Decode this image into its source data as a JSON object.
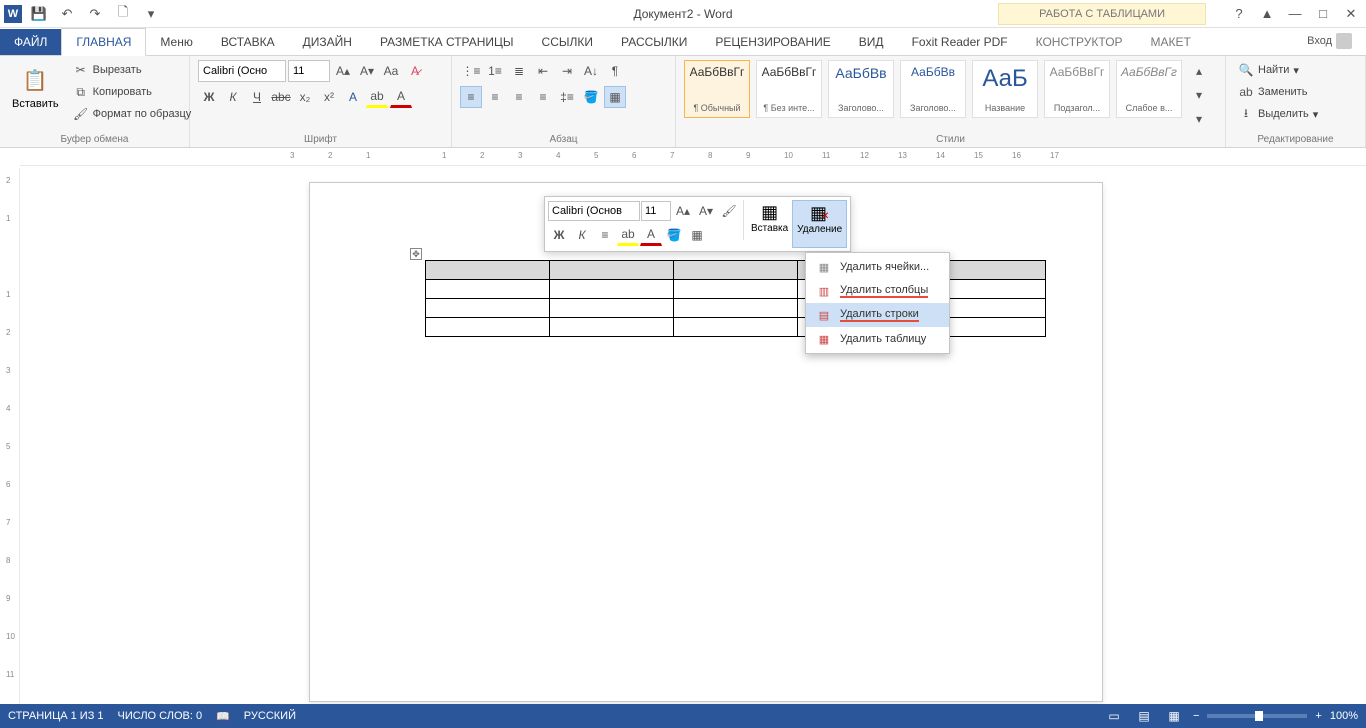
{
  "titlebar": {
    "doc_title": "Документ2 - Word",
    "table_tools": "РАБОТА С ТАБЛИЦАМИ"
  },
  "tabs": {
    "file": "ФАЙЛ",
    "home": "ГЛАВНАЯ",
    "menu": "Меню",
    "insert": "ВСТАВКА",
    "design": "ДИЗАЙН",
    "layout": "РАЗМЕТКА СТРАНИЦЫ",
    "references": "ССЫЛКИ",
    "mailings": "РАССЫЛКИ",
    "review": "РЕЦЕНЗИРОВАНИЕ",
    "view": "ВИД",
    "foxit": "Foxit Reader PDF",
    "constructor": "КОНСТРУКТОР",
    "maket": "МАКЕТ",
    "signin": "Вход"
  },
  "ribbon": {
    "clipboard": {
      "paste": "Вставить",
      "cut": "Вырезать",
      "copy": "Копировать",
      "format_painter": "Формат по образцу",
      "label": "Буфер обмена"
    },
    "font": {
      "name": "Calibri (Осно",
      "size": "11",
      "label": "Шрифт"
    },
    "paragraph": {
      "label": "Абзац"
    },
    "styles": {
      "label": "Стили",
      "preview_text": "АаБбВвГг",
      "preview_text_short": "АаБбВв",
      "preview_text_big": "АаБ",
      "items": [
        {
          "name": "¶ Обычный"
        },
        {
          "name": "¶ Без инте..."
        },
        {
          "name": "Заголово..."
        },
        {
          "name": "Заголово..."
        },
        {
          "name": "Название"
        },
        {
          "name": "Подзагол..."
        },
        {
          "name": "Слабое в..."
        }
      ]
    },
    "editing": {
      "find": "Найти",
      "replace": "Заменить",
      "select": "Выделить",
      "label": "Редактирование"
    }
  },
  "mini": {
    "font_name": "Calibri (Основ",
    "font_size": "11",
    "insert": "Вставка",
    "delete": "Удаление"
  },
  "delete_menu": {
    "cells": "Удалить ячейки...",
    "columns": "Удалить столбцы",
    "rows": "Удалить строки",
    "table": "Удалить таблицу"
  },
  "status": {
    "page": "СТРАНИЦА 1 ИЗ 1",
    "words": "ЧИСЛО СЛОВ: 0",
    "lang": "РУССКИЙ",
    "zoom": "100%"
  },
  "ruler_h": [
    "3",
    "2",
    "1",
    "",
    "1",
    "2",
    "3",
    "4",
    "5",
    "6",
    "7",
    "8",
    "9",
    "10",
    "11",
    "12",
    "13",
    "14",
    "15",
    "16",
    "17"
  ],
  "ruler_v": [
    "2",
    "1",
    "",
    "1",
    "2",
    "3",
    "4",
    "5",
    "6",
    "7",
    "8",
    "9",
    "10",
    "11"
  ]
}
